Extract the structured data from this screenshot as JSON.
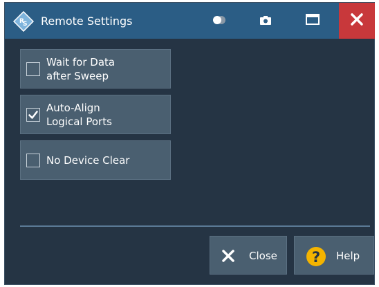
{
  "window": {
    "title": "Remote Settings",
    "icons": {
      "logo": "rohde-schwarz-logo",
      "toggle": "toggle-icon",
      "camera": "camera-icon",
      "maximize": "maximize-icon",
      "close": "close-icon"
    },
    "colors": {
      "titlebar": "#2b5d85",
      "close": "#c8383b",
      "background": "#253444",
      "button": "#4a5f70"
    }
  },
  "options": [
    {
      "label_line1": "Wait for Data",
      "label_line2": "after Sweep",
      "checked": false
    },
    {
      "label_line1": "Auto-Align",
      "label_line2": "Logical Ports",
      "checked": true
    },
    {
      "label_line1": "No Device Clear",
      "label_line2": "",
      "checked": false
    }
  ],
  "actions": {
    "close_label": "Close",
    "help_label": "Help"
  }
}
